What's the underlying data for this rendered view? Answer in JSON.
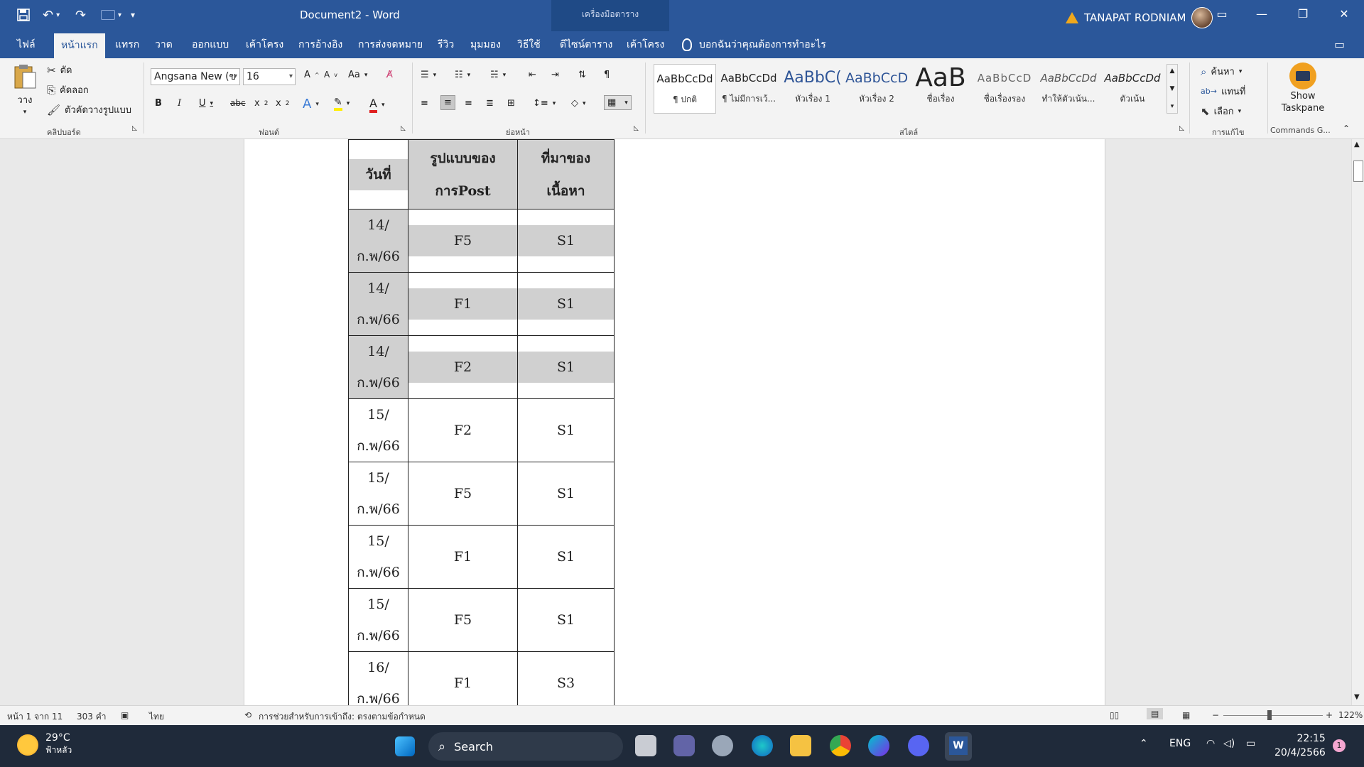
{
  "titlebar": {
    "doc_title": "Document2  -  Word",
    "context_tab": "เครื่องมือตาราง",
    "user_name": "TANAPAT RODNIAM"
  },
  "tabs": {
    "file": "ไฟล์",
    "home": "หน้าแรก",
    "insert": "แทรก",
    "draw": "วาด",
    "design": "ออกแบบ",
    "layout": "เค้าโครง",
    "references": "การอ้างอิง",
    "mailings": "การส่งจดหมาย",
    "review": "รีวิว",
    "view": "มุมมอง",
    "help": "วิธีใช้",
    "table_design": "ดีไซน์ตาราง",
    "table_layout": "เค้าโครง",
    "tell_me": "บอกฉันว่าคุณต้องการทำอะไร"
  },
  "ribbon": {
    "clipboard": {
      "paste": "วาง",
      "cut": "ตัด",
      "copy": "คัดลอก",
      "format_painter": "ตัวคัดวางรูปแบบ",
      "label": "คลิปบอร์ด"
    },
    "font": {
      "name": "Angsana New (ข",
      "size": "16",
      "case_label": "Aa",
      "label": "ฟอนต์"
    },
    "paragraph": {
      "label": "ย่อหน้า"
    },
    "styles": {
      "label": "สไตล์",
      "items": [
        {
          "sample": "AaBbCcDd",
          "name": "¶ ปกติ"
        },
        {
          "sample": "AaBbCcDd",
          "name": "¶ ไม่มีการเว้..."
        },
        {
          "sample": "AaBbC(",
          "name": "หัวเรื่อง 1"
        },
        {
          "sample": "AaBbCcD",
          "name": "หัวเรื่อง 2"
        },
        {
          "sample": "AaB",
          "name": "ชื่อเรื่อง"
        },
        {
          "sample": "AaBbCcD",
          "name": "ชื่อเรื่องรอง"
        },
        {
          "sample": "AaBbCcDd",
          "name": "ทำให้ตัวเน้น..."
        },
        {
          "sample": "AaBbCcDd",
          "name": "ตัวเน้น"
        }
      ]
    },
    "editing": {
      "find": "ค้นหา",
      "replace": "แทนที่",
      "select": "เลือก",
      "label": "การแก้ไข"
    },
    "taskpane": {
      "show": "Show",
      "taskpane": "Taskpane",
      "label": "Commands G..."
    }
  },
  "table": {
    "headers": {
      "date": "วันที่",
      "format_line1": "รูปแบบของ",
      "format_line2": "การPost",
      "source_line1": "ที่มาของ",
      "source_line2": "เนื้อหา"
    },
    "rows": [
      {
        "d1": "14/",
        "d2": "ก.พ/66",
        "format": "F5",
        "source": "S1"
      },
      {
        "d1": "14/",
        "d2": "ก.พ/66",
        "format": "F1",
        "source": "S1"
      },
      {
        "d1": "14/",
        "d2": "ก.พ/66",
        "format": "F2",
        "source": "S1"
      },
      {
        "d1": "15/",
        "d2": "ก.พ/66",
        "format": "F2",
        "source": "S1"
      },
      {
        "d1": "15/",
        "d2": "ก.พ/66",
        "format": "F5",
        "source": "S1"
      },
      {
        "d1": "15/",
        "d2": "ก.พ/66",
        "format": "F1",
        "source": "S1"
      },
      {
        "d1": "15/",
        "d2": "ก.พ/66",
        "format": "F5",
        "source": "S1"
      },
      {
        "d1": "16/",
        "d2": "ก.พ/66",
        "format": "F1",
        "source": "S3"
      }
    ]
  },
  "status": {
    "page": "หน้า 1 จาก 11",
    "words": "303 คำ",
    "language": "ไทย",
    "accessibility": "การช่วยสำหรับการเข้าถึง: ตรงตามข้อกำหนด",
    "zoom": "122%"
  },
  "taskbar": {
    "temp": "29°C",
    "weather": "ฟ้าหลัว",
    "search": "Search",
    "lang": "ENG",
    "time": "22:15",
    "date": "20/4/2566",
    "badge": "1"
  }
}
